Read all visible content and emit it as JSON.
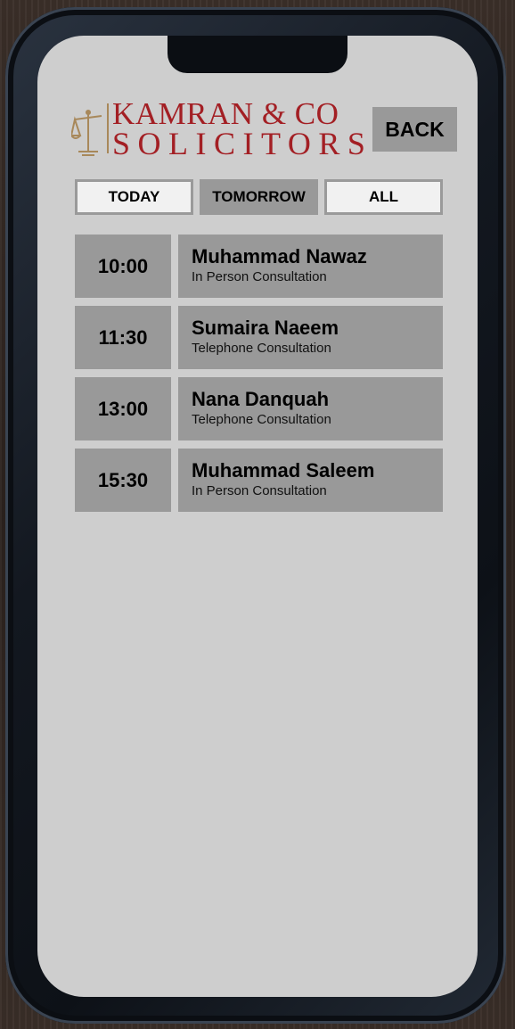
{
  "header": {
    "logo_line1": "KAMRAN & CO",
    "logo_line2": "SOLICITORS",
    "back_label": "BACK"
  },
  "tabs": [
    {
      "label": "TODAY",
      "active": false
    },
    {
      "label": "TOMORROW",
      "active": true
    },
    {
      "label": "ALL",
      "active": false
    }
  ],
  "appointments": [
    {
      "time": "10:00",
      "name": "Muhammad Nawaz",
      "type": "In Person Consultation"
    },
    {
      "time": "11:30",
      "name": "Sumaira Naeem",
      "type": "Telephone Consultation"
    },
    {
      "time": "13:00",
      "name": "Nana Danquah",
      "type": "Telephone Consultation"
    },
    {
      "time": "15:30",
      "name": "Muhammad Saleem",
      "type": "In Person Consultation"
    }
  ],
  "colors": {
    "brand_red": "#a31f24",
    "brand_gold": "#a8885a",
    "screen_bg": "#cecece",
    "tile_gray": "#999999"
  }
}
